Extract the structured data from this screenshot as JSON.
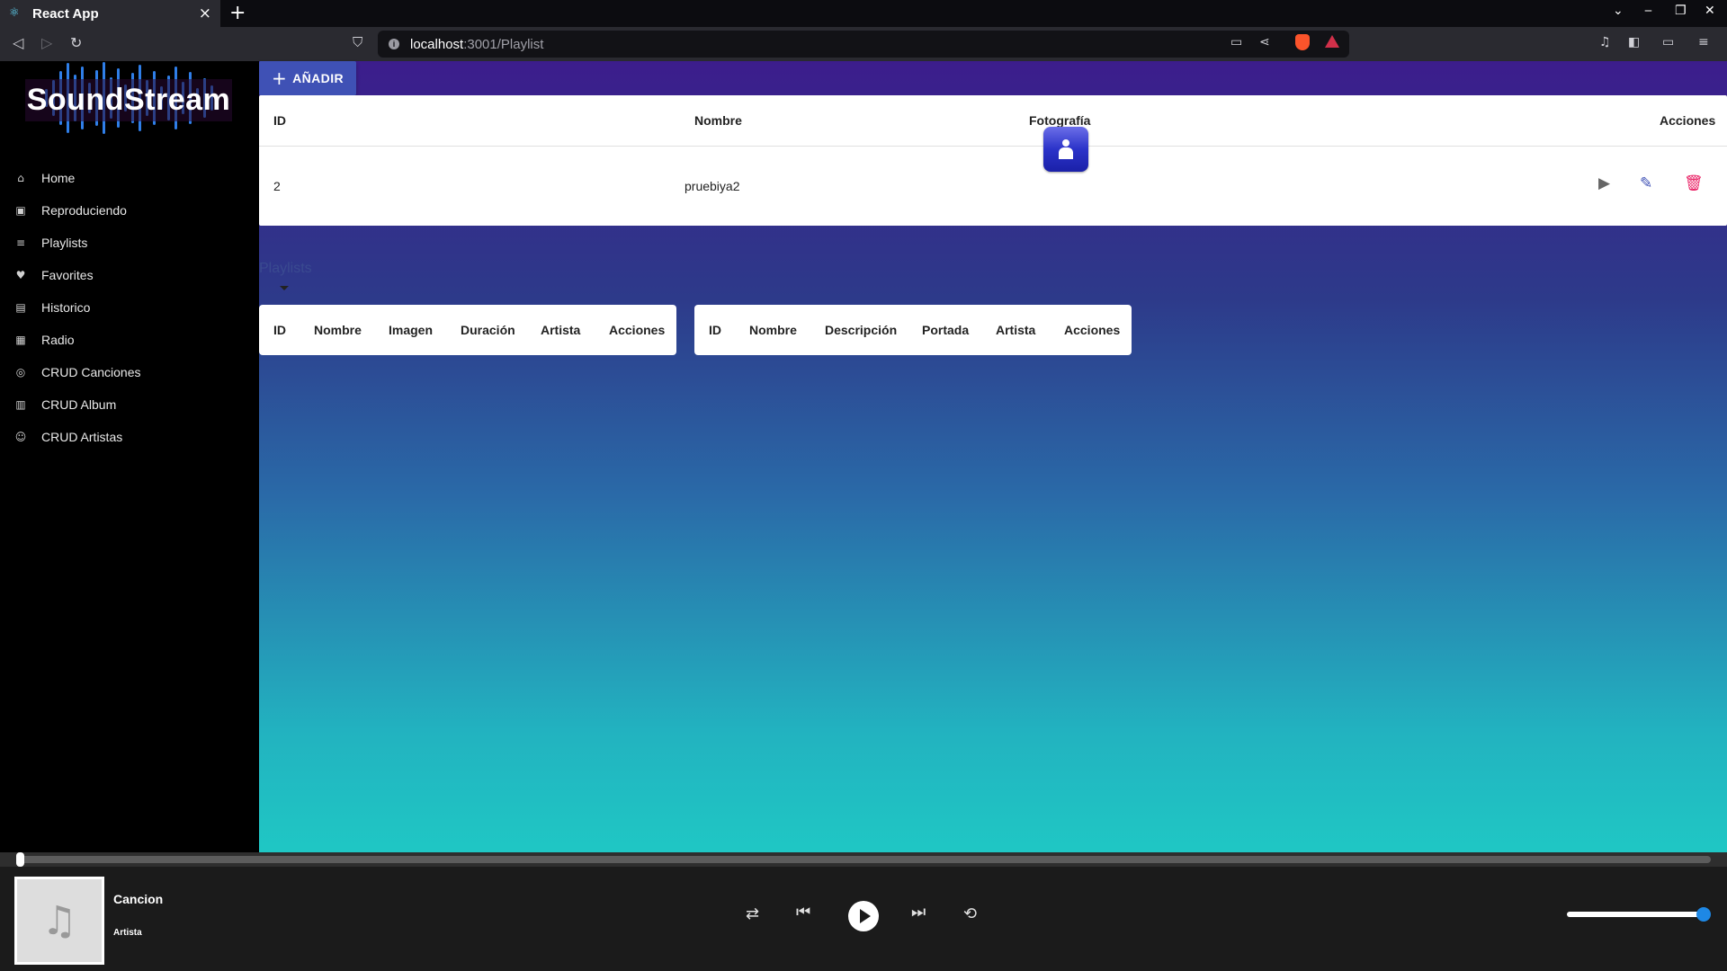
{
  "browser": {
    "tab_title": "React App",
    "tab_close": "×",
    "new_tab": "+",
    "url_host": "localhost",
    "url_path": ":3001/Playlist"
  },
  "sidebar": {
    "logo_text": "SoundStream",
    "items": [
      {
        "label": "Home",
        "icon": "home-icon",
        "glyph": "⌂"
      },
      {
        "label": "Reproduciendo",
        "icon": "radio-icon",
        "glyph": "▣"
      },
      {
        "label": "Playlists",
        "icon": "playlist-icon",
        "glyph": "≡"
      },
      {
        "label": "Favorites",
        "icon": "heart-icon",
        "glyph": "♥"
      },
      {
        "label": "Historico",
        "icon": "history-icon",
        "glyph": "▤"
      },
      {
        "label": "Radio",
        "icon": "radio-icon",
        "glyph": "▦"
      },
      {
        "label": "CRUD Canciones",
        "icon": "disc-icon",
        "glyph": "◎"
      },
      {
        "label": "CRUD Album",
        "icon": "album-icon",
        "glyph": "▥"
      },
      {
        "label": "CRUD Artistas",
        "icon": "people-icon",
        "glyph": "☺"
      }
    ]
  },
  "main": {
    "add_button": "AÑADIR",
    "table": {
      "headers": {
        "id": "ID",
        "nombre": "Nombre",
        "foto": "Fotografía",
        "acciones": "Acciones"
      },
      "rows": [
        {
          "id": "2",
          "nombre": "pruebiya2"
        }
      ]
    },
    "select_label": "Playlists",
    "songs_table_headers": [
      "ID",
      "Nombre",
      "Imagen",
      "Duración",
      "Artista",
      "Acciones"
    ],
    "albums_table_headers": [
      "ID",
      "Nombre",
      "Descripción",
      "Portada",
      "Artista",
      "Acciones"
    ]
  },
  "player": {
    "song": "Cancion",
    "artist": "Artista",
    "progress": 0,
    "volume": 0.95
  },
  "colors": {
    "accent": "#3f51b5",
    "delete": "#e91e63",
    "sidebar_bg": "#000000",
    "gradient_top": "#3c1d8c",
    "gradient_bottom": "#1fc7c4"
  }
}
